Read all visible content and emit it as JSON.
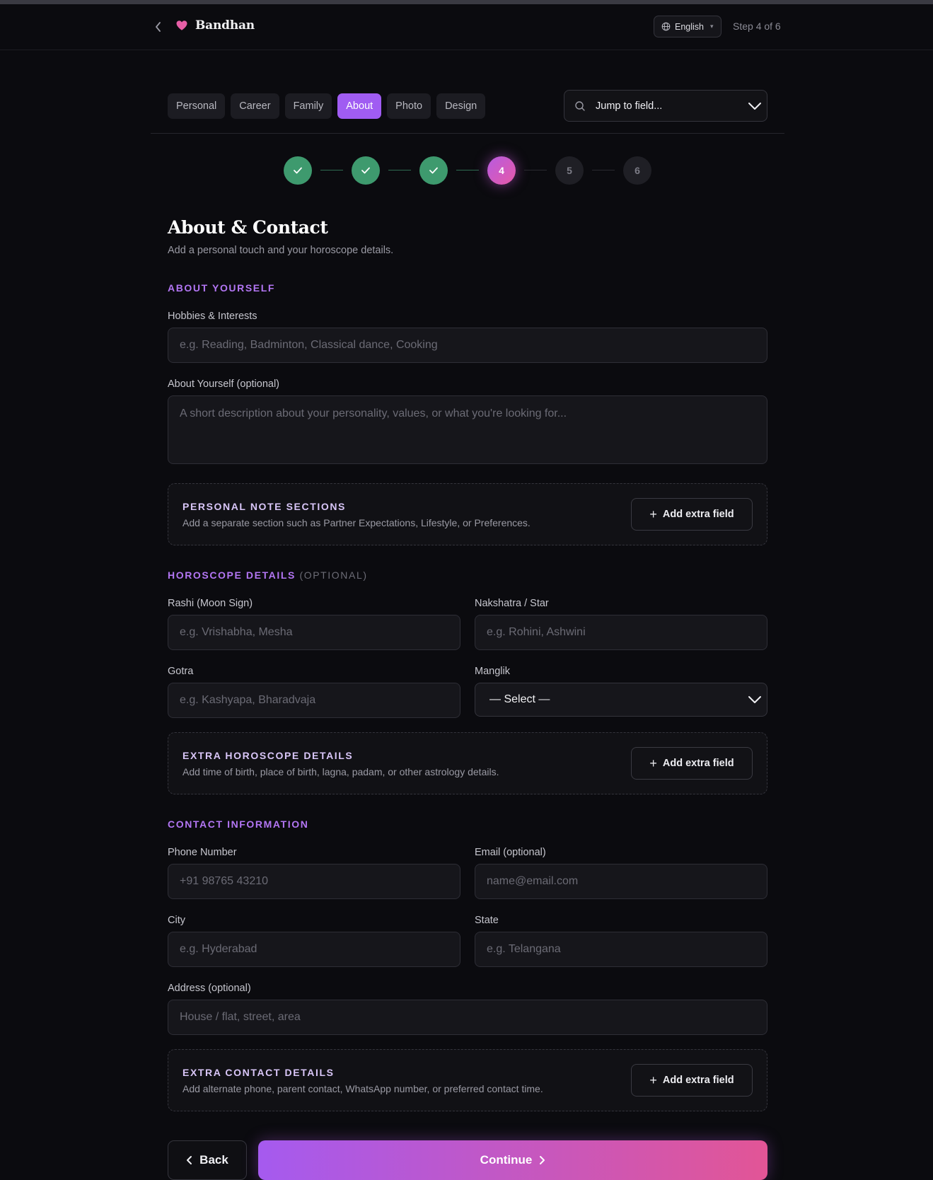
{
  "header": {
    "brand": "Bandhan",
    "language": "English",
    "step_label": "Step 4 of 6"
  },
  "tabs": [
    {
      "label": "Personal",
      "active": false
    },
    {
      "label": "Career",
      "active": false
    },
    {
      "label": "Family",
      "active": false
    },
    {
      "label": "About",
      "active": true
    },
    {
      "label": "Photo",
      "active": false
    },
    {
      "label": "Design",
      "active": false
    }
  ],
  "jump": {
    "placeholder": "Jump to field..."
  },
  "stepper": {
    "steps": [
      {
        "status": "done",
        "label": ""
      },
      {
        "status": "done",
        "label": ""
      },
      {
        "status": "done",
        "label": ""
      },
      {
        "status": "current",
        "label": "4"
      },
      {
        "status": "todo",
        "label": "5"
      },
      {
        "status": "todo",
        "label": "6"
      }
    ]
  },
  "page": {
    "title": "About & Contact",
    "subtitle": "Add a personal touch and your horoscope details."
  },
  "about": {
    "heading": "ABOUT YOURSELF",
    "hobbies_label": "Hobbies & Interests",
    "hobbies_placeholder": "e.g. Reading, Badminton, Classical dance, Cooking",
    "about_label": "About Yourself (optional)",
    "about_placeholder": "A short description about your personality, values, or what you're looking for...",
    "note_box": {
      "title": "PERSONAL NOTE SECTIONS",
      "desc": "Add a separate section such as Partner Expectations, Lifestyle, or Preferences.",
      "button": "Add extra field"
    }
  },
  "horoscope": {
    "heading": "HOROSCOPE DETAILS",
    "heading_opt": "(OPTIONAL)",
    "rashi_label": "Rashi (Moon Sign)",
    "rashi_placeholder": "e.g. Vrishabha, Mesha",
    "nakshatra_label": "Nakshatra / Star",
    "nakshatra_placeholder": "e.g. Rohini, Ashwini",
    "gotra_label": "Gotra",
    "gotra_placeholder": "e.g. Kashyapa, Bharadvaja",
    "manglik_label": "Manglik",
    "manglik_value": "— Select —",
    "extra_box": {
      "title": "EXTRA HOROSCOPE DETAILS",
      "desc": "Add time of birth, place of birth, lagna, padam, or other astrology details.",
      "button": "Add extra field"
    }
  },
  "contact": {
    "heading": "CONTACT INFORMATION",
    "phone_label": "Phone Number",
    "phone_placeholder": "+91 98765 43210",
    "email_label": "Email (optional)",
    "email_placeholder": "name@email.com",
    "city_label": "City",
    "city_placeholder": "e.g. Hyderabad",
    "state_label": "State",
    "state_placeholder": "e.g. Telangana",
    "address_label": "Address (optional)",
    "address_placeholder": "House / flat, street, area",
    "extra_box": {
      "title": "EXTRA CONTACT DETAILS",
      "desc": "Add alternate phone, parent contact, WhatsApp number, or preferred contact time.",
      "button": "Add extra field"
    }
  },
  "footer": {
    "back": "Back",
    "continue": "Continue"
  },
  "colors": {
    "accent": "#a05cf2",
    "accent_pink": "#e25596",
    "done_green": "#3e9a6e",
    "background": "#0b0b0f"
  },
  "icons": [
    "chevron-left-icon",
    "heart-icon",
    "globe-icon",
    "search-icon",
    "chevron-down-icon",
    "check-icon",
    "plus-icon",
    "chevron-right-icon"
  ]
}
